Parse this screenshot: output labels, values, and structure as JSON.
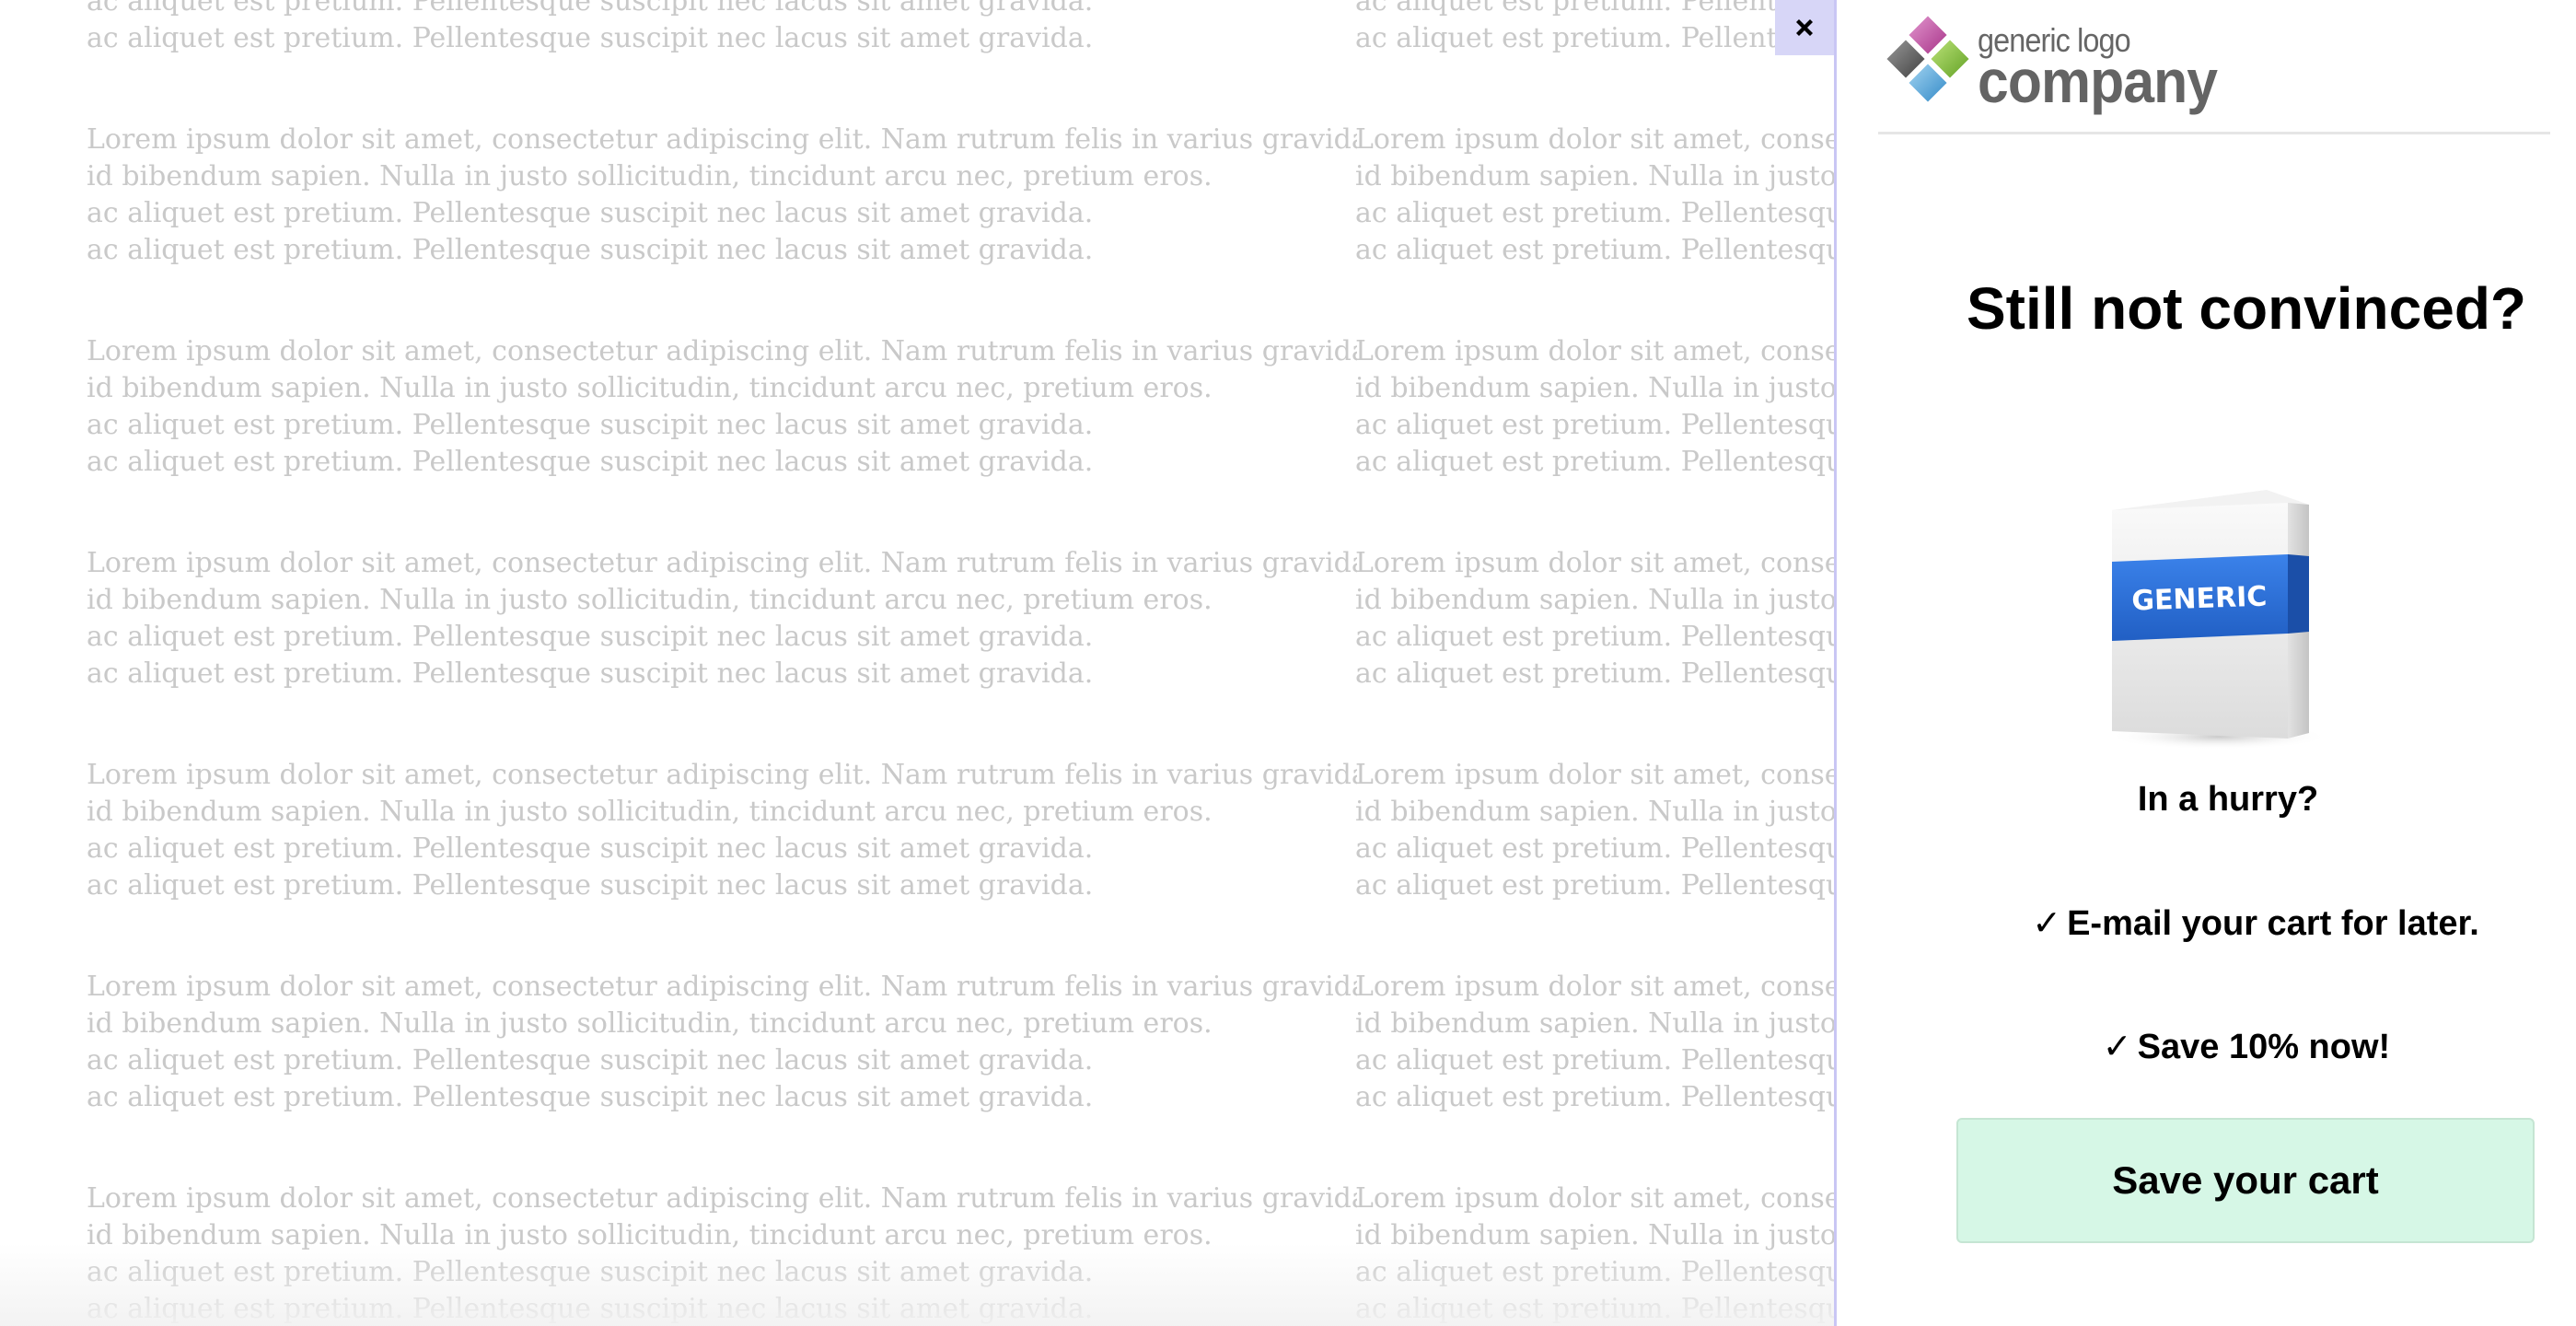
{
  "background": {
    "paragraph_lines": [
      "Lorem ipsum dolor sit amet, consectetur adipiscing elit. Nam rutrum felis in varius gravida.",
      "id bibendum sapien. Nulla in justo sollicitudin, tincidunt arcu nec, pretium eros.",
      "ac aliquet est pretium. Pellentesque suscipit nec lacus sit amet gravida.",
      "ac aliquet est pretium. Pellentesque suscipit nec lacus sit amet gravida."
    ],
    "text_color": "#c9c9c9"
  },
  "close_button": {
    "icon": "close-icon",
    "background": "#d7d6f7"
  },
  "panel": {
    "logo": {
      "small_text": "generic logo",
      "big_text": "company"
    },
    "headline": "Still not convinced?",
    "product_image": {
      "label": "GENERIC",
      "accent_color": "#2d6fd6"
    },
    "subheading": "In a hurry?",
    "benefits": [
      {
        "check": "✓",
        "text": "E-mail your cart for later."
      },
      {
        "check": "✓",
        "text": "Save 10% now!"
      }
    ],
    "cta": {
      "label": "Save your cart",
      "background": "#d6f7e6"
    },
    "border_color": "#c9c6f4"
  }
}
